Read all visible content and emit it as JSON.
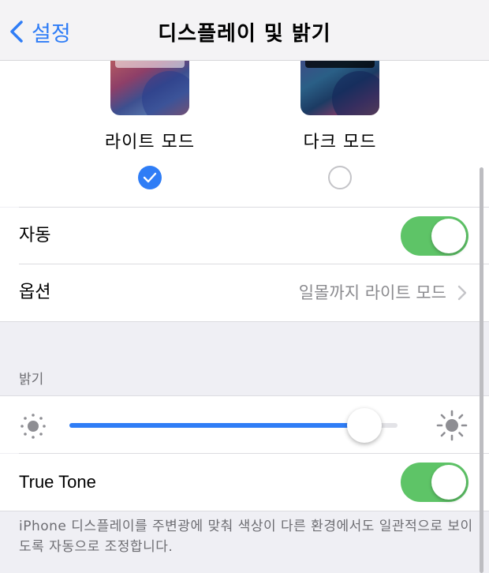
{
  "nav": {
    "back_label": "설정",
    "title": "디스플레이 및 밝기"
  },
  "appearance": {
    "light_label": "라이트 모드",
    "dark_label": "다크 모드",
    "selected": "light"
  },
  "auto": {
    "label": "자동",
    "on": true
  },
  "options": {
    "label": "옵션",
    "value": "일몰까지 라이트 모드"
  },
  "brightness": {
    "header": "밝기",
    "level": 0.9
  },
  "true_tone": {
    "label": "True Tone",
    "on": true,
    "footnote": "iPhone 디스플레이를 주변광에 맞춰 색상이 다른 환경에서도 일관적으로 보이도록 자동으로 조정합니다."
  },
  "colors": {
    "accent": "#2f7df6",
    "toggle_on": "#5ec467"
  },
  "icons": [
    "chevron-left-icon",
    "checkmark-icon",
    "chevron-right-icon",
    "sun-small-icon",
    "sun-large-icon"
  ]
}
